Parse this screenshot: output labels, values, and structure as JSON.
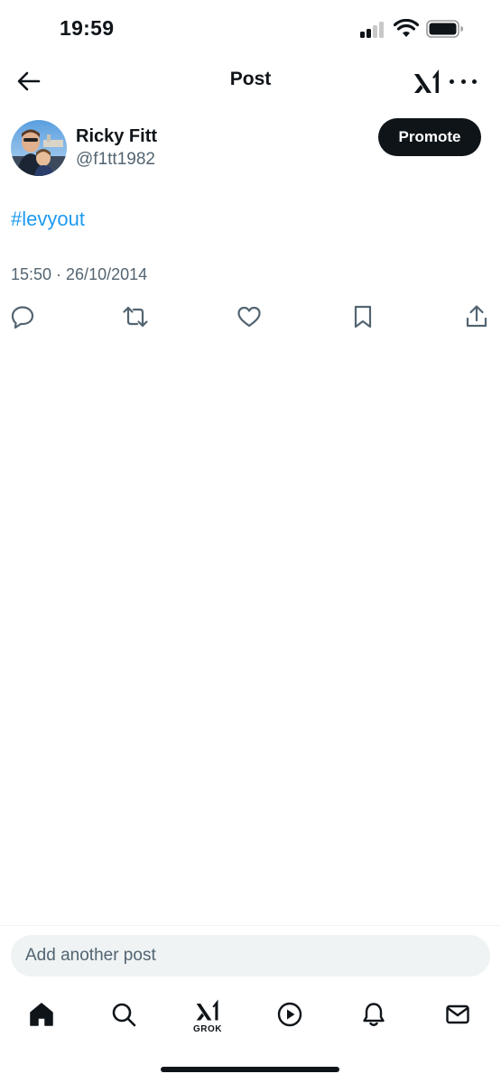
{
  "status_bar": {
    "time": "19:59",
    "signal_bars_active": 3,
    "signal_bars_total": 4,
    "wifi": "wifi-icon",
    "battery": "battery-icon"
  },
  "header": {
    "title": "Post",
    "back_icon": "arrow-left-icon",
    "grok_icon": "grok-logo-icon",
    "more_icon": "ellipsis-icon"
  },
  "post": {
    "author_name": "Ricky Fitt",
    "author_handle": "@f1tt1982",
    "promote_label": "Promote",
    "text": "#levyout",
    "meta": "15:50 · 26/10/2014",
    "link_color": "#1d9bf0",
    "actions": [
      "reply-icon",
      "repost-icon",
      "like-icon",
      "bookmark-icon",
      "share-icon"
    ]
  },
  "compose": {
    "placeholder": "Add another post"
  },
  "tabbar": {
    "items": [
      "home-icon",
      "search-icon",
      "grok-icon",
      "video-icon",
      "notifications-icon",
      "messages-icon"
    ],
    "grok_label": "GROK"
  },
  "colors": {
    "text": "#0f1419",
    "secondary": "#536471",
    "accent": "#1d9bf0",
    "input_bg": "#eff3f4"
  }
}
